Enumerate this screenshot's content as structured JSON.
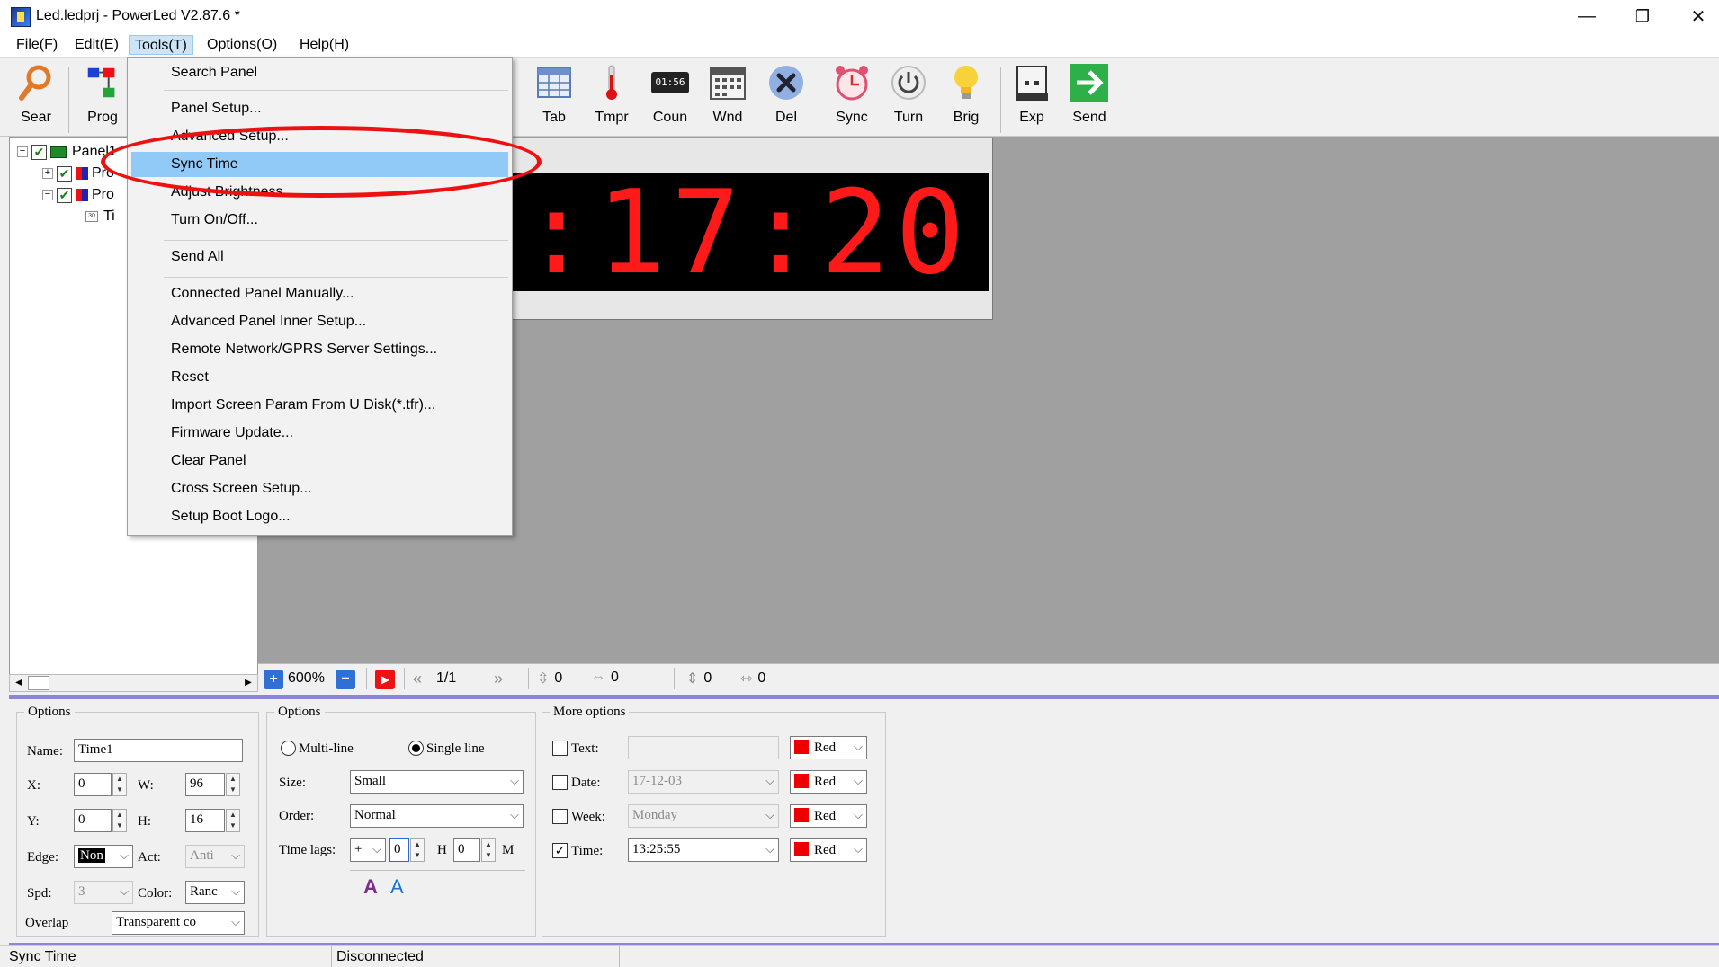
{
  "window": {
    "title": "Led.ledprj - PowerLed V2.87.6 *",
    "minimize_glyph": "—",
    "restore_glyph": "❐",
    "close_glyph": "✕"
  },
  "menubar": {
    "items": [
      "File(F)",
      "Edit(E)",
      "Tools(T)",
      "Options(O)",
      "Help(H)"
    ]
  },
  "toolbar": {
    "buttons": [
      {
        "label": "Sear",
        "icon": "magnifier-icon"
      },
      {
        "label": "Prog",
        "icon": "program-tree-icon"
      },
      {
        "label": "Tab",
        "icon": "table-icon"
      },
      {
        "label": "Tmpr",
        "icon": "thermometer-icon"
      },
      {
        "label": "Coun",
        "icon": "counter-icon"
      },
      {
        "label": "Wnd",
        "icon": "calendar-window-icon"
      },
      {
        "label": "Del",
        "icon": "delete-icon"
      },
      {
        "label": "Sync",
        "icon": "alarm-clock-icon"
      },
      {
        "label": "Turn",
        "icon": "power-icon"
      },
      {
        "label": "Brig",
        "icon": "bulb-icon"
      },
      {
        "label": "Exp",
        "icon": "usb-export-icon"
      },
      {
        "label": "Send",
        "icon": "send-arrow-icon"
      }
    ],
    "counter_icon_text": "01:56"
  },
  "tree": {
    "rows": [
      "Panel1",
      "Pro",
      "Pro",
      "Ti"
    ],
    "row3_icon_text": "30"
  },
  "led": {
    "display_text": ":17:20"
  },
  "canvas_strip": {
    "zoom": "600%",
    "page": "1/1",
    "v_offset": "0",
    "h_offset": "0",
    "v_size": "0",
    "h_size": "0"
  },
  "tools_menu": {
    "items": [
      "Search Panel",
      "Panel Setup...",
      "Advanced Setup...",
      "Sync Time",
      "Adjust Brightness...",
      "Turn On/Off...",
      "Send All",
      "Connected Panel Manually...",
      "Advanced Panel Inner Setup...",
      "Remote Network/GPRS Server Settings...",
      "Reset",
      "Import Screen Param From U Disk(*.tfr)...",
      "Firmware Update...",
      "Clear Panel",
      "Cross Screen Setup...",
      "Setup Boot Logo..."
    ],
    "highlighted": "Sync Time"
  },
  "props": {
    "options1": {
      "legend": "Options",
      "name_label": "Name:",
      "name_value": "Time1",
      "x_label": "X:",
      "x_value": "0",
      "w_label": "W:",
      "w_value": "96",
      "y_label": "Y:",
      "y_value": "0",
      "h_label": "H:",
      "h_value": "16",
      "edge_label": "Edge:",
      "edge_value": "Non",
      "act_label": "Act:",
      "act_value": "Anti",
      "spd_label": "Spd:",
      "spd_value": "3",
      "color_label": "Color:",
      "color_value": "Ranc",
      "overlap_label": "Overlap",
      "overlap_value": "Transparent co"
    },
    "options2": {
      "legend": "Options",
      "multiline_label": "Multi-line",
      "singleline_label": "Single line",
      "size_label": "Size:",
      "size_value": "Small",
      "order_label": "Order:",
      "order_value": "Normal",
      "timelags_label": "Time lags:",
      "sign_value": "+",
      "hours_value": "0",
      "h_unit": "H",
      "minutes_value": "0",
      "m_unit": "M"
    },
    "more": {
      "legend": "More options",
      "text_label": "Text:",
      "text_value": "",
      "date_label": "Date:",
      "date_value": "17-12-03",
      "week_label": "Week:",
      "week_value": "Monday",
      "time_label": "Time:",
      "time_value": "13:25:55",
      "color_red": "Red",
      "red_hex": "#ee0000"
    }
  },
  "statusbar": {
    "left": "Sync Time",
    "middle": "Disconnected"
  }
}
